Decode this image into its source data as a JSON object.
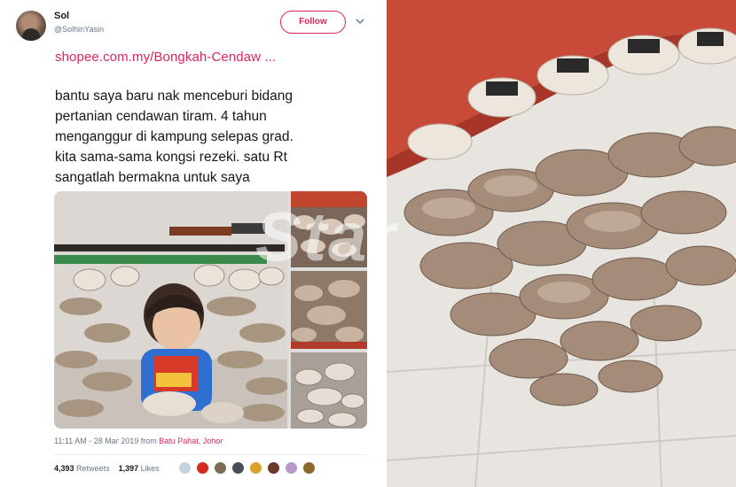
{
  "tweet": {
    "user": {
      "name": "Sol",
      "handle": "@SolhinYasin"
    },
    "follow_label": "Follow",
    "link": "shopee.com.my/Bongkah-Cendaw ...",
    "text_lines": [
      "bantu saya baru nak menceburi bidang",
      "pertanian cendawan tiram. 4 tahun",
      "menganggur di kampung selepas grad.",
      "kita sama-sama kongsi rezeki. satu Rt",
      "sangatlah bermakna untuk saya"
    ],
    "timestamp": "11:11 AM - 28 Mar 2019 from",
    "place": "Batu Pahat, Johor",
    "retweets": "4,393",
    "retweets_label": "Retweets",
    "likes": "1,397",
    "likes_label": "Likes"
  },
  "watermark": "Star",
  "colors": {
    "accent": "#e0245e",
    "muted": "#657786",
    "text": "#14171a"
  },
  "icons": {
    "menu": "chevron-down-icon"
  }
}
